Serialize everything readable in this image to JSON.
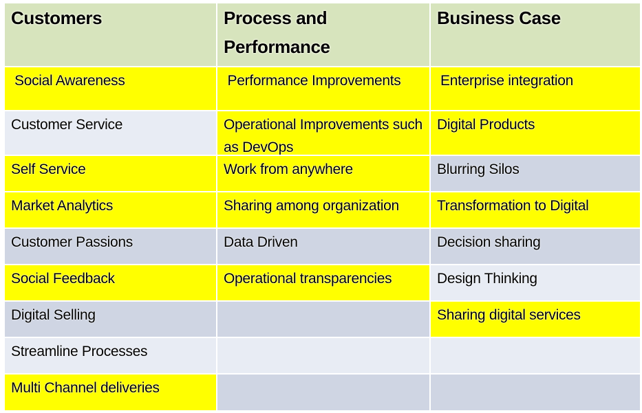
{
  "colors": {
    "header": "#d7e4bd",
    "highlight_yellow": "#ffff00",
    "row_light": "#e8ecf4",
    "row_dark": "#cfd5e3",
    "text": "#000000"
  },
  "table": {
    "headers": [
      "Customers",
      "Process and Performance",
      "Business Case"
    ],
    "rows": [
      [
        " Social Awareness",
        " Performance Improvements",
        " Enterprise integration"
      ],
      [
        "Customer Service",
        "Operational Improvements such as DevOps",
        "Digital Products"
      ],
      [
        "Self Service",
        "Work from anywhere",
        "Blurring Silos"
      ],
      [
        "Market Analytics",
        "Sharing among organization",
        "Transformation to Digital"
      ],
      [
        "Customer Passions",
        "Data Driven",
        "Decision sharing"
      ],
      [
        "Social Feedback",
        "Operational transparencies",
        "Design Thinking"
      ],
      [
        "Digital Selling",
        "",
        "Sharing digital services"
      ],
      [
        "Streamline Processes",
        "",
        ""
      ],
      [
        "Multi Channel deliveries",
        "",
        ""
      ]
    ],
    "cell_fill": [
      [
        "yellow",
        "yellow",
        "yellow"
      ],
      [
        "light",
        "yellow",
        "yellow"
      ],
      [
        "yellow",
        "yellow",
        "dark"
      ],
      [
        "yellow",
        "yellow",
        "yellow"
      ],
      [
        "dark",
        "dark",
        "dark"
      ],
      [
        "yellow",
        "yellow",
        "light"
      ],
      [
        "dark",
        "dark",
        "yellow"
      ],
      [
        "light",
        "light",
        "light"
      ],
      [
        "yellow",
        "dark",
        "dark"
      ]
    ]
  }
}
